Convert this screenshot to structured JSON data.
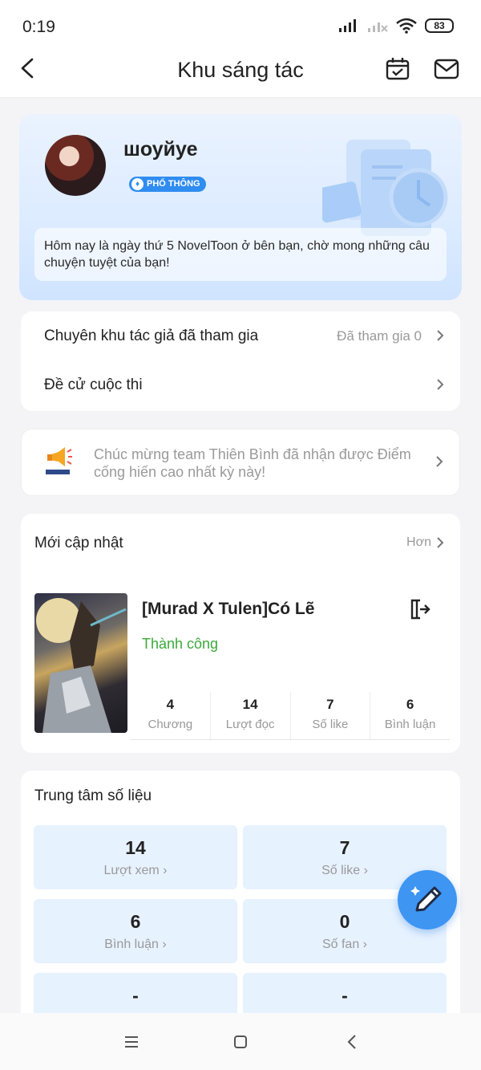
{
  "status_bar": {
    "time": "0:19",
    "battery": "83"
  },
  "header": {
    "title": "Khu sáng tác"
  },
  "profile": {
    "username": "шоуйуе",
    "tier": "PHỔ THÔNG",
    "welcome": "Hôm nay là ngày thứ 5 NovelToon ở bên bạn, chờ mong những câu chuyện tuyệt của bạn!"
  },
  "menu": [
    {
      "label": "Chuyên khu tác giả đã tham gia",
      "value": "Đã tham gia 0"
    },
    {
      "label": "Đề cử cuộc thi",
      "value": ""
    }
  ],
  "notice": {
    "text": "Chúc mừng team Thiên Bình đã nhận được Điểm cống hiến cao nhất kỳ này!"
  },
  "updates": {
    "title": "Mới cập nhật",
    "more": "Hơn",
    "book": {
      "title": "[Murad X Tulen]Có Lẽ",
      "status": "Thành công",
      "stats": [
        {
          "value": "4",
          "label": "Chương"
        },
        {
          "value": "14",
          "label": "Lượt đọc"
        },
        {
          "value": "7",
          "label": "Số like"
        },
        {
          "value": "6",
          "label": "Bình luận"
        }
      ]
    }
  },
  "data_center": {
    "title": "Trung tâm số liệu",
    "tiles": [
      {
        "value": "14",
        "label": "Lượt xem"
      },
      {
        "value": "7",
        "label": "Số like"
      },
      {
        "value": "6",
        "label": "Bình luận"
      },
      {
        "value": "0",
        "label": "Số fan"
      },
      {
        "value": "-",
        "label": ""
      },
      {
        "value": "-",
        "label": ""
      }
    ]
  },
  "colors": {
    "accent": "#3e95f2",
    "success": "#3aa93a",
    "badge": "#2f8cf0"
  }
}
